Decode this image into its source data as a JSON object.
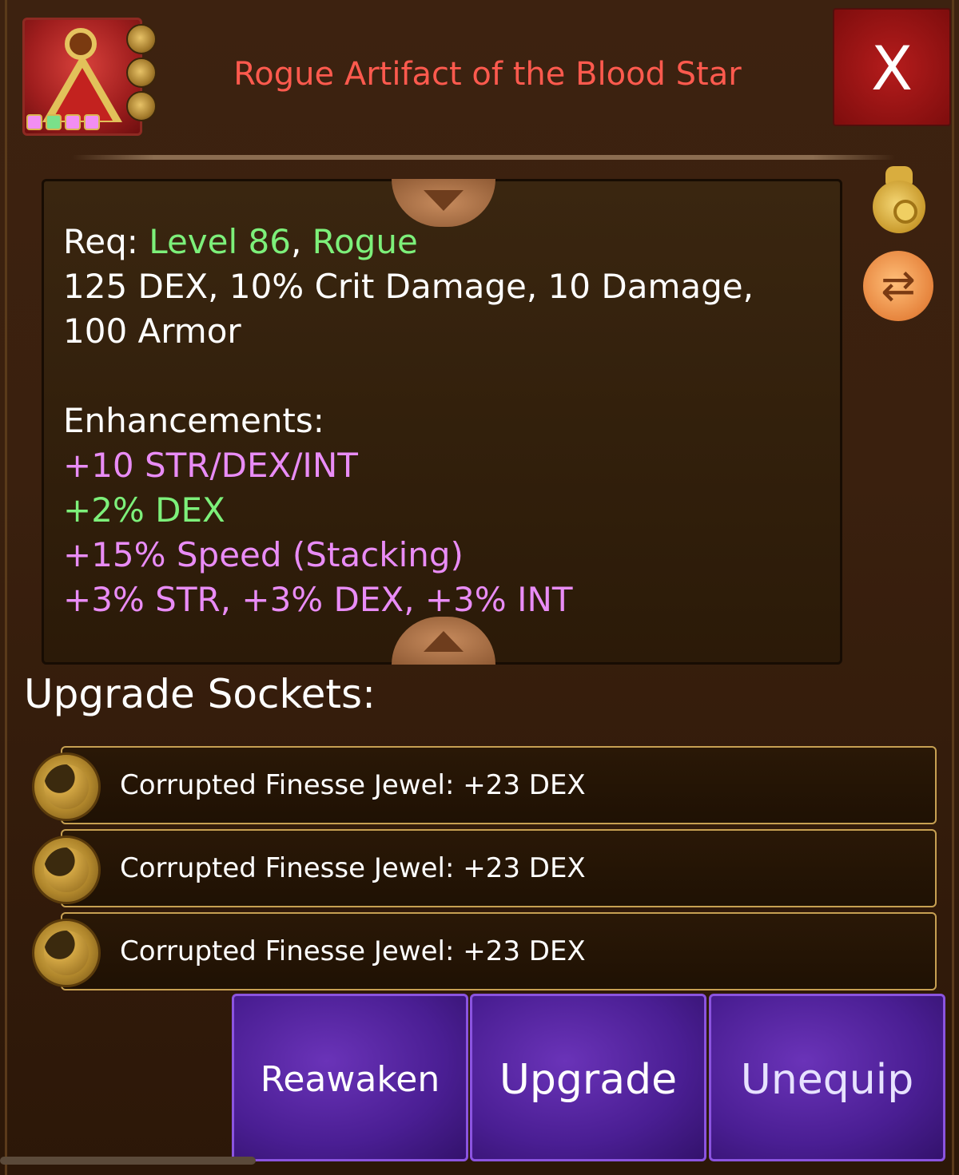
{
  "header": {
    "title": "Rogue Artifact of the Blood Star",
    "close_label": "X"
  },
  "item_icon": {
    "gem_colors": [
      "#f28ef2",
      "#7ae08a",
      "#f28ef2",
      "#f28ef2"
    ],
    "frame_color": "#e2c15a"
  },
  "description": {
    "req_prefix": "Req: ",
    "req_level": "Level 86",
    "req_sep": ", ",
    "req_class": "Rogue",
    "stats_line1": "125 DEX, 10% Crit Damage, 10 Damage,",
    "stats_line2": "100 Armor",
    "enhancements_title": "Enhancements:",
    "enhancements": [
      {
        "text": "+10 STR/DEX/INT",
        "color": "#e98cf6"
      },
      {
        "text": "+2% DEX",
        "color": "#7df07a"
      },
      {
        "text": "+15% Speed (Stacking)",
        "color": "#e98cf6"
      },
      {
        "text": "+3% STR, +3% DEX, +3% INT",
        "color": "#e98cf6"
      }
    ]
  },
  "side_icons": {
    "bag": "coin-bag-icon",
    "swap": "swap-arrows-icon"
  },
  "sockets": {
    "title": "Upgrade Sockets:",
    "items": [
      {
        "label": "Corrupted Finesse Jewel: +23 DEX"
      },
      {
        "label": "Corrupted Finesse Jewel: +23 DEX"
      },
      {
        "label": "Corrupted Finesse Jewel: +23 DEX"
      }
    ]
  },
  "actions": {
    "reawaken": "Reawaken",
    "upgrade": "Upgrade",
    "unequip": "Unequip"
  }
}
